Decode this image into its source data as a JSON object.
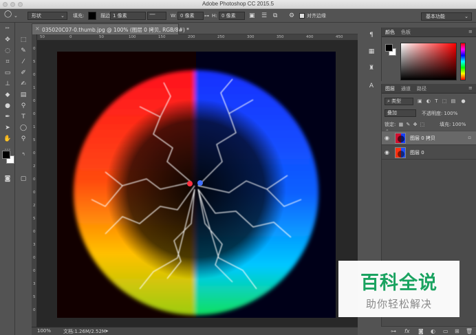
{
  "app": {
    "title": "Adobe Photoshop CC 2015.5"
  },
  "options_bar": {
    "mode": "形状",
    "fill_label": "填充:",
    "stroke_label": "描边:",
    "stroke_width": "1 像素",
    "w_label": "W:",
    "w_value": "0 像素",
    "h_label": "H:",
    "h_value": "0 像素",
    "align_edges": "对齐边缘",
    "workspace": "基本功能"
  },
  "document": {
    "tab_title": "035020C07-0.thumb.jpg @ 100% (图层 0 拷贝, RGB/8#) *",
    "ruler_h": [
      "50",
      "0",
      "50",
      "100",
      "150",
      "200",
      "250",
      "300",
      "350",
      "400",
      "450"
    ],
    "ruler_v": [
      "0",
      "5",
      "0",
      "1",
      "0",
      "0",
      "1",
      "5",
      "0",
      "2",
      "0",
      "0",
      "2",
      "5",
      "0",
      "3",
      "0",
      "0",
      "3",
      "5",
      "0"
    ],
    "zoom": "100%",
    "doc_size": "文档:1.26M/2.52M"
  },
  "color_panel": {
    "tabs": [
      "颜色",
      "色板"
    ],
    "foreground": "#000000",
    "background": "#ffffff"
  },
  "layers_panel": {
    "tabs": [
      "图层",
      "通道",
      "路径"
    ],
    "filter_kind": "类型",
    "blend_mode": "叠加",
    "opacity_label": "不透明度:",
    "opacity_value": "100%",
    "lock_label": "锁定:",
    "fill_label": "填充:",
    "fill_value": "100%",
    "layers": [
      {
        "name": "图层 0 拷贝",
        "selected": true,
        "locked": true
      },
      {
        "name": "图层 0",
        "selected": false,
        "locked": false
      }
    ],
    "footer_icons": [
      "link-icon",
      "fx-icon",
      "mask-icon",
      "adjustment-icon",
      "group-icon",
      "new-layer-icon",
      "trash-icon"
    ]
  },
  "watermark": {
    "main": "百科全说",
    "sub": "助你轻松解决"
  },
  "colors": {
    "ui_bg": "#535353",
    "workspace_bg": "#282828",
    "watermark_green": "#1aa360"
  }
}
